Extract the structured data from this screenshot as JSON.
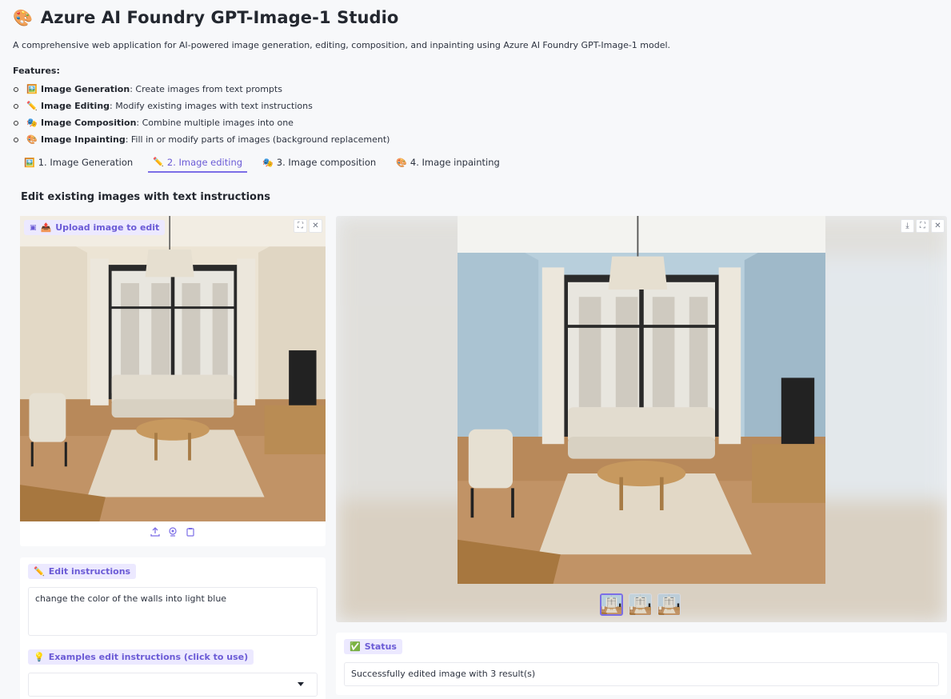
{
  "app": {
    "title": "Azure AI Foundry GPT-Image-1 Studio",
    "title_emoji": "🎨",
    "subtitle": "A comprehensive web application for AI-powered image generation, editing, composition, and inpainting using Azure AI Foundry GPT-Image-1 model."
  },
  "features": {
    "heading": "Features:",
    "items": [
      {
        "icon": "🖼️",
        "name": "Image Generation",
        "desc": ": Create images from text prompts"
      },
      {
        "icon": "✏️",
        "name": "Image Editing",
        "desc": ": Modify existing images with text instructions"
      },
      {
        "icon": "🎭",
        "name": "Image Composition",
        "desc": ": Combine multiple images into one"
      },
      {
        "icon": "🎨",
        "name": "Image Inpainting",
        "desc": ": Fill in or modify parts of images (background replacement)"
      }
    ]
  },
  "tabs": [
    {
      "icon": "🖼️",
      "label": "1. Image Generation",
      "active": false
    },
    {
      "icon": "✏️",
      "label": "2. Image editing",
      "active": true
    },
    {
      "icon": "🎭",
      "label": "3. Image composition",
      "active": false
    },
    {
      "icon": "🎨",
      "label": "4. Image inpainting",
      "active": false
    }
  ],
  "editing": {
    "section_title": "Edit existing images with text instructions",
    "upload_label": "Upload image to edit",
    "upload_label_icon": "📤",
    "instructions_label": "Edit instructions",
    "instructions_icon": "✏️",
    "instructions_value": "change the color of the walls into light blue",
    "examples_label": "Examples edit instructions (click to use)",
    "examples_icon": "💡",
    "examples_selected": ""
  },
  "gallery": {
    "thumbnail_count": 3,
    "selected_index": 0
  },
  "status": {
    "label": "Status",
    "icon": "✅",
    "message": "Successfully edited image with 3 result(s)"
  },
  "colors": {
    "accent": "#7c6ee6",
    "chip_bg": "#ece9ff",
    "wall_original": "#ece4d4",
    "wall_edited": "#b8cfdc"
  }
}
